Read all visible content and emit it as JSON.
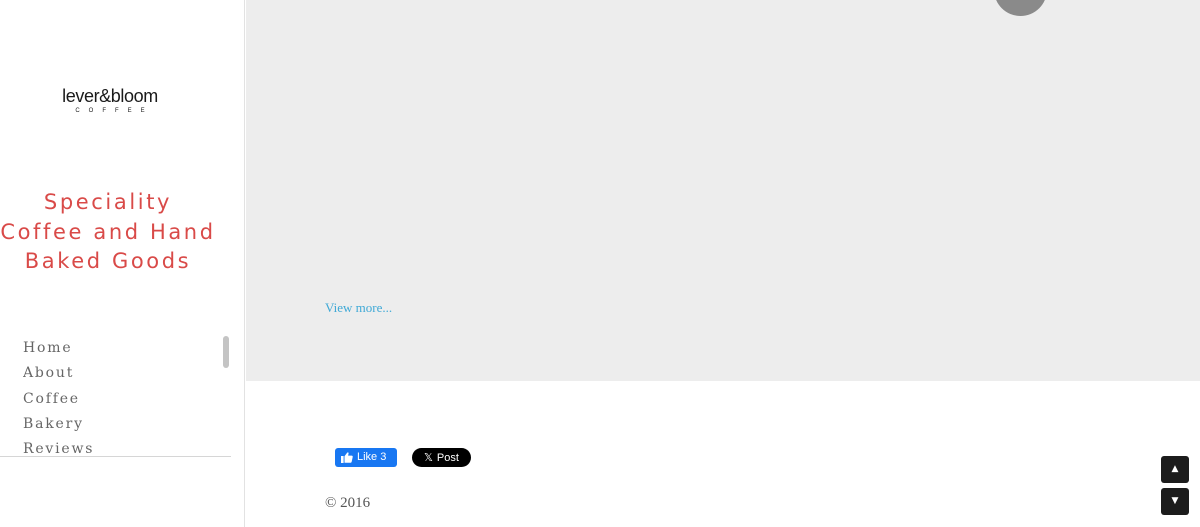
{
  "brand": {
    "logo_main": "lever&bloom",
    "logo_sub": "COFFEE"
  },
  "sidebar": {
    "tagline": "Speciality Coffee and Hand Baked Goods",
    "nav_items": [
      {
        "label": "Home"
      },
      {
        "label": "About"
      },
      {
        "label": "Coffee"
      },
      {
        "label": "Bakery"
      },
      {
        "label": "Reviews"
      }
    ]
  },
  "main": {
    "view_more_link": "View more..."
  },
  "social": {
    "facebook_like_label": "Like 3",
    "x_post_label": "Post",
    "x_glyph": "𝕏"
  },
  "footer": {
    "copyright": "© 2016"
  },
  "controls": {
    "scroll_up_glyph": "▲",
    "scroll_down_glyph": "▼"
  },
  "colors": {
    "tagline": "#d94a48",
    "link": "#3fa9d6",
    "main_background": "#ededed",
    "facebook_blue": "#1877f2"
  }
}
